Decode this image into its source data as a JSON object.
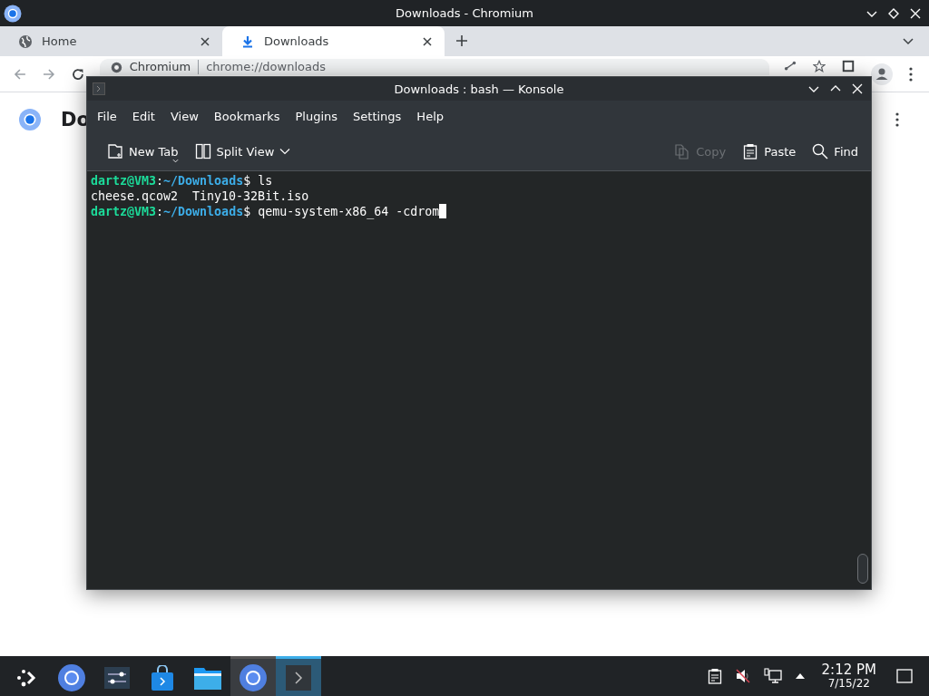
{
  "chromium": {
    "title": "Downloads - Chromium",
    "tabs": [
      {
        "label": "Home",
        "kind": "globe",
        "selected": false
      },
      {
        "label": "Downloads",
        "kind": "download",
        "selected": true
      }
    ],
    "address": {
      "site": "Chromium",
      "url": "chrome://downloads"
    },
    "page_heading": "Do"
  },
  "konsole": {
    "title": "Downloads : bash — Konsole",
    "menu": [
      "File",
      "Edit",
      "View",
      "Bookmarks",
      "Plugins",
      "Settings",
      "Help"
    ],
    "toolbar": [
      {
        "label": "New Tab",
        "kind": "new-tab",
        "disabled": false
      },
      {
        "label": "Split View",
        "kind": "split-view",
        "disabled": false
      },
      {
        "label": "Copy",
        "kind": "copy",
        "disabled": true
      },
      {
        "label": "Paste",
        "kind": "paste",
        "disabled": false
      },
      {
        "label": "Find",
        "kind": "find",
        "disabled": false
      }
    ],
    "lines": [
      [
        {
          "kind": "user",
          "text": "dartz@VM3"
        },
        {
          "kind": "plain",
          "text": ":"
        },
        {
          "kind": "path",
          "text": "~/Downloads"
        },
        {
          "kind": "plain",
          "text": "$ ls"
        }
      ],
      [
        {
          "kind": "plain",
          "text": "cheese.qcow2  Tiny10-32Bit.iso"
        }
      ],
      [
        {
          "kind": "user",
          "text": "dartz@VM3"
        },
        {
          "kind": "plain",
          "text": ":"
        },
        {
          "kind": "path",
          "text": "~/Downloads"
        },
        {
          "kind": "plain",
          "text": "$ qemu-system-x86_64 -cdrom"
        }
      ]
    ],
    "cursor": true
  },
  "taskbar": {
    "tasks": [
      {
        "kind": "launcher",
        "open": false,
        "selected": false
      },
      {
        "kind": "chromium",
        "open": false,
        "selected": false
      },
      {
        "kind": "settings",
        "open": false,
        "selected": false
      },
      {
        "kind": "store",
        "open": false,
        "selected": false
      },
      {
        "kind": "files",
        "open": false,
        "selected": false
      },
      {
        "kind": "chromium",
        "open": true,
        "selected": false
      },
      {
        "kind": "konsole",
        "open": true,
        "selected": true
      }
    ],
    "time": "2:12 PM",
    "date": "7/15/22"
  }
}
